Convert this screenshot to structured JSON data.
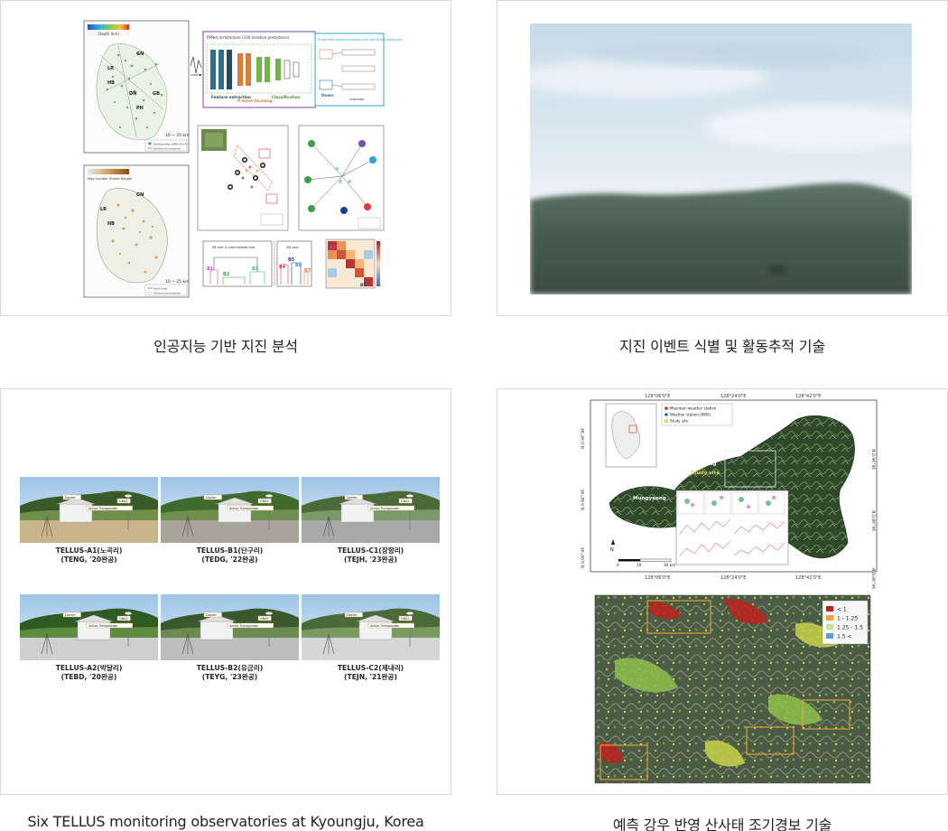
{
  "cards": [
    {
      "caption": "인공지능 기반 지진 분석"
    },
    {
      "caption": "지진 이벤트 식별 및 활동추적 기술"
    },
    {
      "caption": "Six TELLUS monitoring observatories at Kyoungju, Korea"
    },
    {
      "caption": "예측 강우 반영 산사태 조기경보 기술"
    }
  ],
  "ai_figure": {
    "depth_title": "Depth (km)",
    "mag_title": "Mag number (Event Range)",
    "scale_label": "10 ~ 25 km",
    "legend_earthquakes": "Earthquakes (KMA-2017)",
    "legend_tectonic": "Tectonic boundaries",
    "legend_faults": "Fault lines",
    "region_labels": [
      "GN",
      "LR",
      "HB",
      "DN",
      "GB",
      "PH"
    ],
    "arch_title": "RPNet architecture (100 iterative predictions)",
    "ensemble_title": "Ensemble post-processing for the final prediction",
    "stage_feature": "Feature extraction",
    "stage_pwave": "P-wave focusing",
    "stage_classification": "Classification",
    "down_label": "Down",
    "unknown_label": "Unknown",
    "dendro_left_title": "NE part & Intermediate part",
    "dendro_right_title": "SW part",
    "dendro_labels": [
      "B1",
      "B2",
      "B3",
      "B4",
      "B5",
      "B6",
      "B7"
    ]
  },
  "tellus": {
    "stations": [
      {
        "name": "TELLUS-A1(노곡리)",
        "code": "(TENG, '20완공)"
      },
      {
        "name": "TELLUS-B1(단구리)",
        "code": "(TEDG, '22완공)"
      },
      {
        "name": "TELLUS-C1(장항리)",
        "code": "(TEJH, '23완공)"
      },
      {
        "name": "TELLUS-A2(박달리)",
        "code": "(TEBD, '20완공)"
      },
      {
        "name": "TELLUS-B2(유금리)",
        "code": "(TEYG, '23완공)"
      },
      {
        "name": "TELLUS-C2(제내리)",
        "code": "(TEJN, '21완공)"
      }
    ],
    "callout_docker": "Docker",
    "callout_gnss": "GNSS",
    "callout_transponder": "Active Transponder"
  },
  "landslide": {
    "lon_labels": [
      "128°06'0\"E",
      "128°24'0\"E",
      "128°42'0\"E"
    ],
    "lat_labels": [
      "N.0.9€°9€",
      "N.0.8€°9€",
      "N.0.0€°9€"
    ],
    "legend_mountain": "Mountain weather station",
    "legend_weather": "Weather station (KMA)",
    "legend_site": "Study site",
    "place_labels": [
      "Cauae",
      "Mungyeong",
      "Masbong",
      "Study site"
    ],
    "scale_units": [
      "0",
      "10",
      "30 km"
    ],
    "north_label": "N",
    "fs_legend": [
      {
        "label": "< 1",
        "color": "#c0211f"
      },
      {
        "label": "1 - 1.25",
        "color": "#f2a23a"
      },
      {
        "label": "1.25 - 1.5",
        "color": "#c9e29a"
      },
      {
        "label": "1.5 <",
        "color": "#5aa0d8"
      }
    ]
  }
}
